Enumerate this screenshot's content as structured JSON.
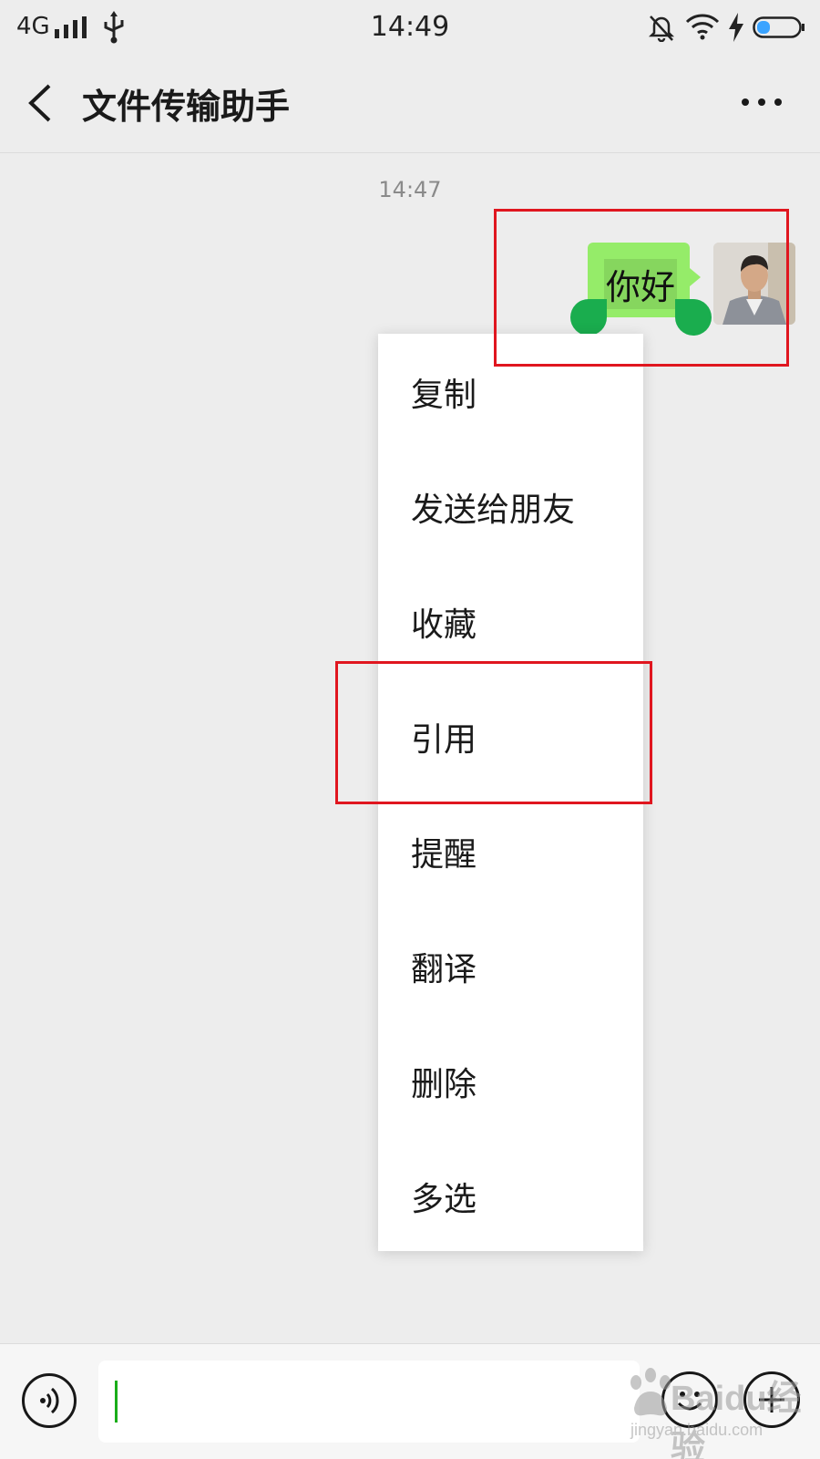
{
  "status_bar": {
    "network": "4G",
    "time": "14:49"
  },
  "header": {
    "title": "文件传输助手"
  },
  "chat": {
    "timestamp": "14:47",
    "message_text": "你好",
    "bubble_color": "#95ec69"
  },
  "context_menu": {
    "items": [
      {
        "label": "复制"
      },
      {
        "label": "发送给朋友"
      },
      {
        "label": "收藏"
      },
      {
        "label": "引用"
      },
      {
        "label": "提醒"
      },
      {
        "label": "翻译"
      },
      {
        "label": "删除"
      },
      {
        "label": "多选"
      }
    ]
  },
  "annotations": {
    "color": "#e0161f"
  },
  "watermark": {
    "main": "Baidu经验",
    "sub": "jingyan.baidu.com"
  },
  "icons": {
    "back": "chevron-left-icon",
    "more": "more-dots-icon",
    "voice": "voice-icon",
    "emoji": "emoji-icon",
    "plus": "plus-icon"
  }
}
